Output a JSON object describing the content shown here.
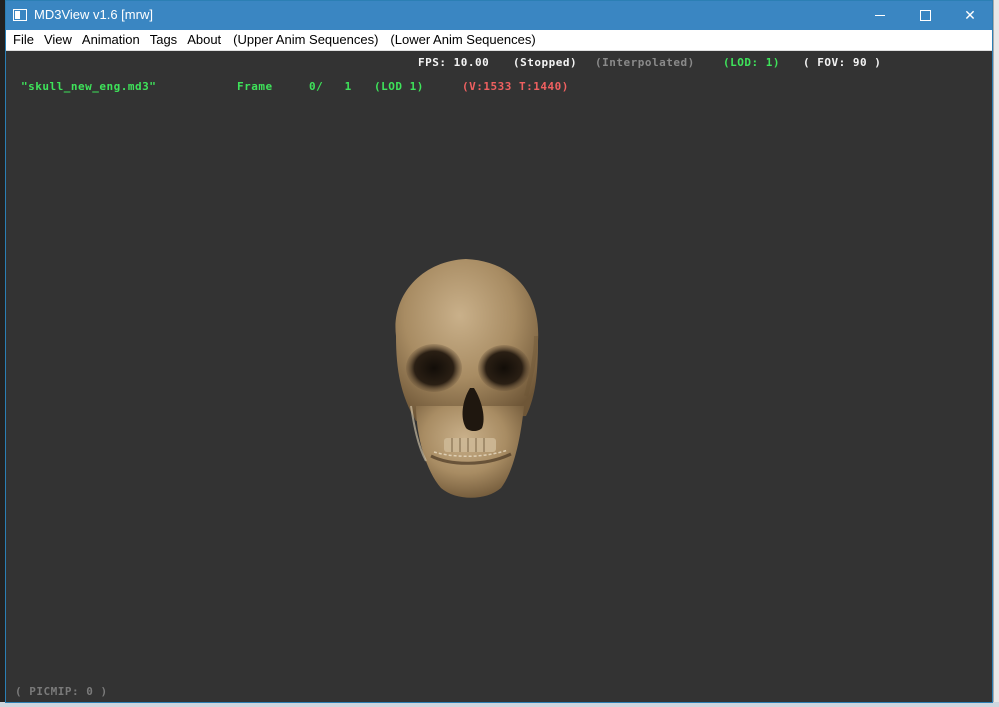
{
  "window": {
    "title": "MD3View v1.6 [mrw]",
    "colors": {
      "titlebar": "#3a86c2",
      "viewport": "#333333",
      "hud_green": "#3ee35a",
      "hud_red": "#f06060",
      "hud_white": "#f4f4f4",
      "hud_gray": "#8a8a8a"
    }
  },
  "controls": {
    "minimize_icon": "minimize-icon",
    "maximize_icon": "maximize-icon",
    "close_glyph": "✕"
  },
  "menu": {
    "items": [
      "File",
      "View",
      "Animation",
      "Tags",
      "About",
      "(Upper Anim Sequences)",
      "(Lower Anim Sequences)"
    ]
  },
  "hud": {
    "fps": "FPS: 10.00",
    "state": "(Stopped)",
    "interp": "(Interpolated)",
    "lod_top": "(LOD: 1)",
    "fov": "( FOV: 90 )",
    "model_name": "\"skull_new_eng.md3\"",
    "frame_label": "Frame",
    "frame_value": "0/   1",
    "lod_model": "(LOD 1)",
    "counts": "(V:1533 T:1440)",
    "picmip": "( PICMIP: 0 )"
  },
  "model": {
    "icon": "skull-model"
  }
}
